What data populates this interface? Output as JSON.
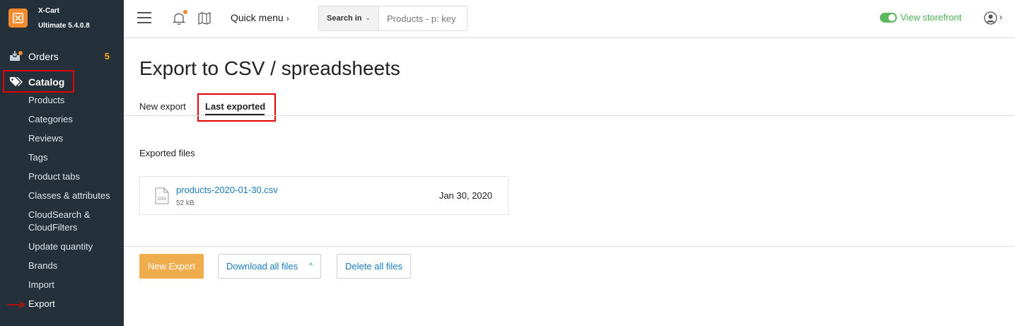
{
  "brand": {
    "name": "X-Cart",
    "version": "Ultimate 5.4.0.8"
  },
  "sidebar": {
    "orders": {
      "label": "Orders",
      "count": "5"
    },
    "catalog": {
      "label": "Catalog"
    },
    "items": [
      {
        "label": "Products"
      },
      {
        "label": "Categories"
      },
      {
        "label": "Reviews"
      },
      {
        "label": "Tags"
      },
      {
        "label": "Product tabs"
      },
      {
        "label": "Classes & attributes"
      },
      {
        "label": "CloudSearch &"
      },
      {
        "label": "CloudFilters"
      },
      {
        "label": "Update quantity"
      },
      {
        "label": "Brands"
      },
      {
        "label": "Import"
      },
      {
        "label": "Export"
      }
    ]
  },
  "header": {
    "quick_menu": "Quick menu",
    "search": {
      "label": "Search in",
      "placeholder": "Products - p: key"
    },
    "view_storefront": "View storefront"
  },
  "main": {
    "title": "Export to CSV / spreadsheets",
    "tabs": [
      {
        "label": "New export",
        "active": false
      },
      {
        "label": "Last exported",
        "active": true
      }
    ],
    "exported_files_label": "Exported files",
    "files": [
      {
        "name": "products-2020-01-30.csv",
        "size": "52 kB",
        "date": "Jan 30, 2020",
        "icon_text": "CSV"
      }
    ],
    "buttons": {
      "new_export": "New Export",
      "download_all": "Download all files",
      "delete_all": "Delete all files"
    }
  },
  "colors": {
    "sidebar_bg": "#24313a",
    "accent_orange": "#f0ad4e",
    "link_blue": "#1a7bb9",
    "highlight_red": "#e30000",
    "storefront_green": "#4caf50"
  }
}
